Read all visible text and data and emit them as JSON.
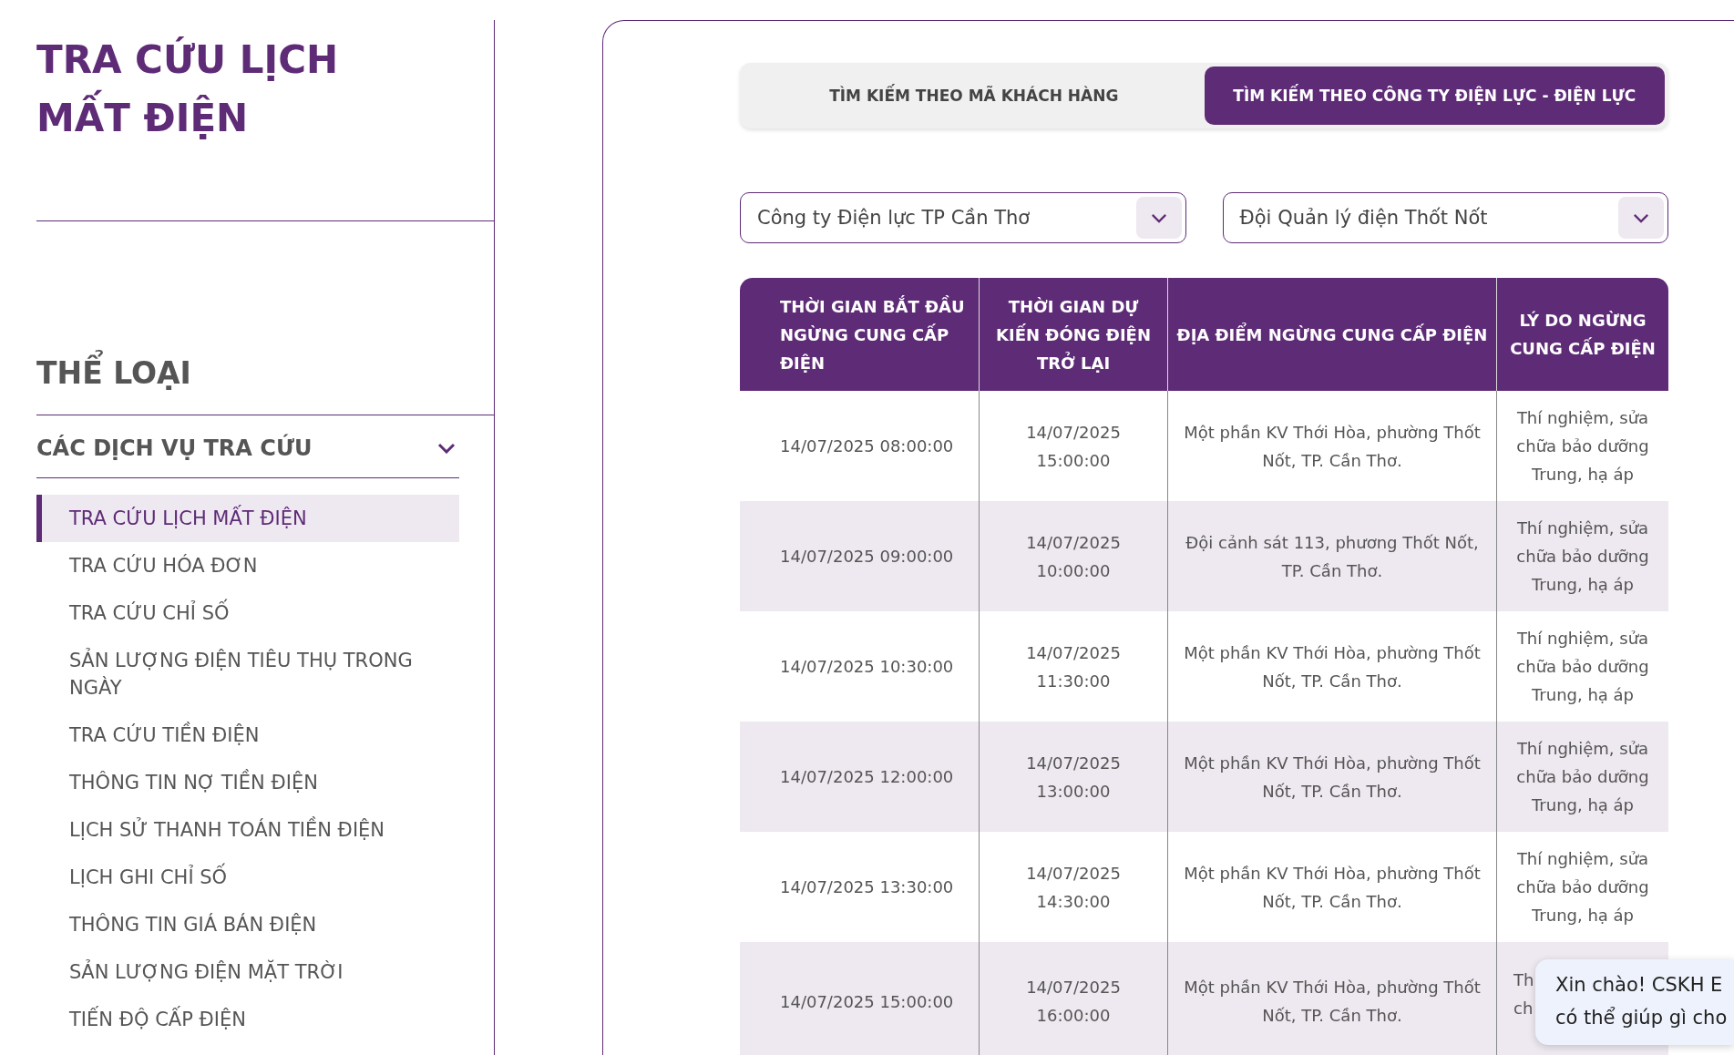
{
  "sidebar": {
    "title": "TRA CỨU LỊCH MẤT ĐIỆN",
    "category_heading": "THỂ LOẠI",
    "group": {
      "label": "CÁC DỊCH VỤ TRA CỨU",
      "expanded": true
    },
    "items": [
      {
        "label": "TRA CỨU LỊCH MẤT ĐIỆN",
        "selected": true
      },
      {
        "label": "TRA CỨU HÓA ĐƠN",
        "selected": false
      },
      {
        "label": "TRA CỨU CHỈ SỐ",
        "selected": false
      },
      {
        "label": "SẢN LƯỢNG ĐIỆN TIÊU THỤ TRONG NGÀY",
        "selected": false
      },
      {
        "label": "TRA CỨU TIỀN ĐIỆN",
        "selected": false
      },
      {
        "label": "THÔNG TIN NỢ TIỀN ĐIỆN",
        "selected": false
      },
      {
        "label": "LỊCH SỬ THANH TOÁN TIỀN ĐIỆN",
        "selected": false
      },
      {
        "label": "LỊCH GHI CHỈ SỐ",
        "selected": false
      },
      {
        "label": "THÔNG TIN GIÁ BÁN ĐIỆN",
        "selected": false
      },
      {
        "label": "SẢN LƯỢNG ĐIỆN MẶT TRỜI",
        "selected": false
      },
      {
        "label": "TIẾN ĐỘ CẤP ĐIỆN",
        "selected": false
      }
    ]
  },
  "tabs": [
    {
      "label": "TÌM KIẾM THEO MÃ KHÁCH HÀNG",
      "selected": false
    },
    {
      "label": "TÌM KIẾM THEO CÔNG TY ĐIỆN LỰC - ĐIỆN LỰC",
      "selected": true
    }
  ],
  "filters": [
    {
      "value": "Công ty Điện lực TP Cần Thơ"
    },
    {
      "value": "Đội Quản lý điện Thốt Nốt"
    }
  ],
  "table": {
    "columns": [
      "THỜI GIAN BẮT ĐẦU NGỪNG CUNG CẤP ĐIỆN",
      "THỜI GIAN DỰ KIẾN ĐÓNG ĐIỆN TRỞ LẠI",
      "ĐỊA ĐIỂM NGỪNG CUNG CẤP ĐIỆN",
      "LÝ DO NGỪNG CUNG CẤP ĐIỆN"
    ],
    "rows": [
      [
        "14/07/2025 08:00:00",
        "14/07/2025 15:00:00",
        "Một phần KV Thới Hòa, phường Thốt Nốt, TP. Cần Thơ.",
        "Thí nghiệm, sửa chữa bảo dưỡng Trung, hạ áp"
      ],
      [
        "14/07/2025 09:00:00",
        "14/07/2025 10:00:00",
        "Đội cảnh sát 113, phương Thốt Nốt, TP. Cần Thơ.",
        "Thí nghiệm, sửa chữa bảo dưỡng Trung, hạ áp"
      ],
      [
        "14/07/2025 10:30:00",
        "14/07/2025 11:30:00",
        "Một phần KV Thới Hòa, phường Thốt Nốt, TP. Cần Thơ.",
        "Thí nghiệm, sửa chữa bảo dưỡng Trung, hạ áp"
      ],
      [
        "14/07/2025 12:00:00",
        "14/07/2025 13:00:00",
        "Một phần KV Thới Hòa, phường Thốt Nốt, TP. Cần Thơ.",
        "Thí nghiệm, sửa chữa bảo dưỡng Trung, hạ áp"
      ],
      [
        "14/07/2025 13:30:00",
        "14/07/2025 14:30:00",
        "Một phần KV Thới Hòa, phường Thốt Nốt, TP. Cần Thơ.",
        "Thí nghiệm, sửa chữa bảo dưỡng Trung, hạ áp"
      ],
      [
        "14/07/2025 15:00:00",
        "14/07/2025 16:00:00",
        "Một phần KV Thới Hòa, phường Thốt Nốt, TP. Cần Thơ.",
        "Th\nch"
      ]
    ]
  },
  "chat_bubble": {
    "lines": [
      "Xin chào! CSKH E",
      "có thể giúp gì cho"
    ]
  }
}
